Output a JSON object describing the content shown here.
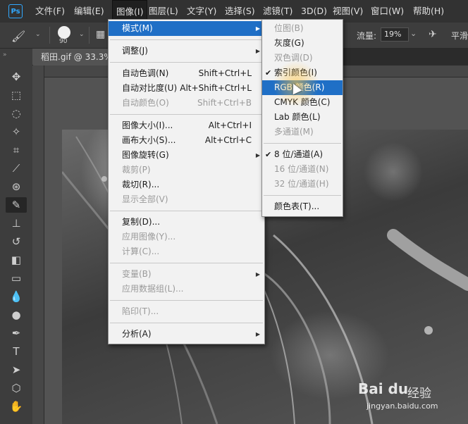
{
  "menubar": {
    "items": [
      "文件(F)",
      "编辑(E)",
      "图像(I)",
      "图层(L)",
      "文字(Y)",
      "选择(S)",
      "滤镜(T)",
      "3D(D)",
      "视图(V)",
      "窗口(W)",
      "帮助(H)"
    ],
    "active_index": 2,
    "logo": "Ps"
  },
  "options_bar": {
    "brush_size": "90",
    "flow_label": "流量:",
    "flow_value": "19%",
    "smoothing_label": "平滑"
  },
  "document_tab": {
    "title": "稻田.gif @ 33.3%"
  },
  "image_menu": {
    "items": [
      {
        "label": "模式(M)",
        "shortcut": "",
        "submenu": true,
        "disabled": false,
        "highlighted": true
      },
      {
        "divider": true
      },
      {
        "label": "调整(J)",
        "shortcut": "",
        "submenu": true,
        "disabled": false
      },
      {
        "divider": true
      },
      {
        "label": "自动色调(N)",
        "shortcut": "Shift+Ctrl+L",
        "disabled": false
      },
      {
        "label": "自动对比度(U)",
        "shortcut": "Alt+Shift+Ctrl+L",
        "disabled": false
      },
      {
        "label": "自动颜色(O)",
        "shortcut": "Shift+Ctrl+B",
        "disabled": true
      },
      {
        "divider": true
      },
      {
        "label": "图像大小(I)...",
        "shortcut": "Alt+Ctrl+I",
        "disabled": false
      },
      {
        "label": "画布大小(S)...",
        "shortcut": "Alt+Ctrl+C",
        "disabled": false
      },
      {
        "label": "图像旋转(G)",
        "shortcut": "",
        "submenu": true,
        "disabled": false
      },
      {
        "label": "裁剪(P)",
        "shortcut": "",
        "disabled": true
      },
      {
        "label": "裁切(R)...",
        "shortcut": "",
        "disabled": false
      },
      {
        "label": "显示全部(V)",
        "shortcut": "",
        "disabled": true
      },
      {
        "divider": true
      },
      {
        "label": "复制(D)...",
        "shortcut": "",
        "disabled": false
      },
      {
        "label": "应用图像(Y)...",
        "shortcut": "",
        "disabled": true
      },
      {
        "label": "计算(C)...",
        "shortcut": "",
        "disabled": true
      },
      {
        "divider": true
      },
      {
        "label": "变量(B)",
        "shortcut": "",
        "submenu": true,
        "disabled": true
      },
      {
        "label": "应用数据组(L)...",
        "shortcut": "",
        "disabled": true
      },
      {
        "divider": true
      },
      {
        "label": "陷印(T)...",
        "shortcut": "",
        "disabled": true
      },
      {
        "divider": true
      },
      {
        "label": "分析(A)",
        "shortcut": "",
        "submenu": true,
        "disabled": false
      }
    ]
  },
  "mode_submenu": {
    "items": [
      {
        "label": "位图(B)",
        "disabled": true
      },
      {
        "label": "灰度(G)",
        "disabled": false
      },
      {
        "label": "双色调(D)",
        "disabled": true
      },
      {
        "label": "索引颜色(I)",
        "disabled": false,
        "checked": true
      },
      {
        "label": "RGB 颜色(R)",
        "disabled": false,
        "highlighted": true
      },
      {
        "label": "CMYK 颜色(C)",
        "disabled": false
      },
      {
        "label": "Lab 颜色(L)",
        "disabled": false
      },
      {
        "label": "多通道(M)",
        "disabled": true
      },
      {
        "divider": true
      },
      {
        "label": "8 位/通道(A)",
        "disabled": false,
        "checked": true
      },
      {
        "label": "16 位/通道(N)",
        "disabled": true
      },
      {
        "label": "32 位/通道(H)",
        "disabled": true
      },
      {
        "divider": true
      },
      {
        "label": "颜色表(T)...",
        "disabled": false
      }
    ]
  },
  "watermark": {
    "logo": "Bai du",
    "jingyan": "经验",
    "url": "jingyan.baidu.com"
  },
  "colors": {
    "highlight": "#1f6fc6",
    "menubar": "#323232",
    "menu_bg": "#f2f2f2"
  }
}
